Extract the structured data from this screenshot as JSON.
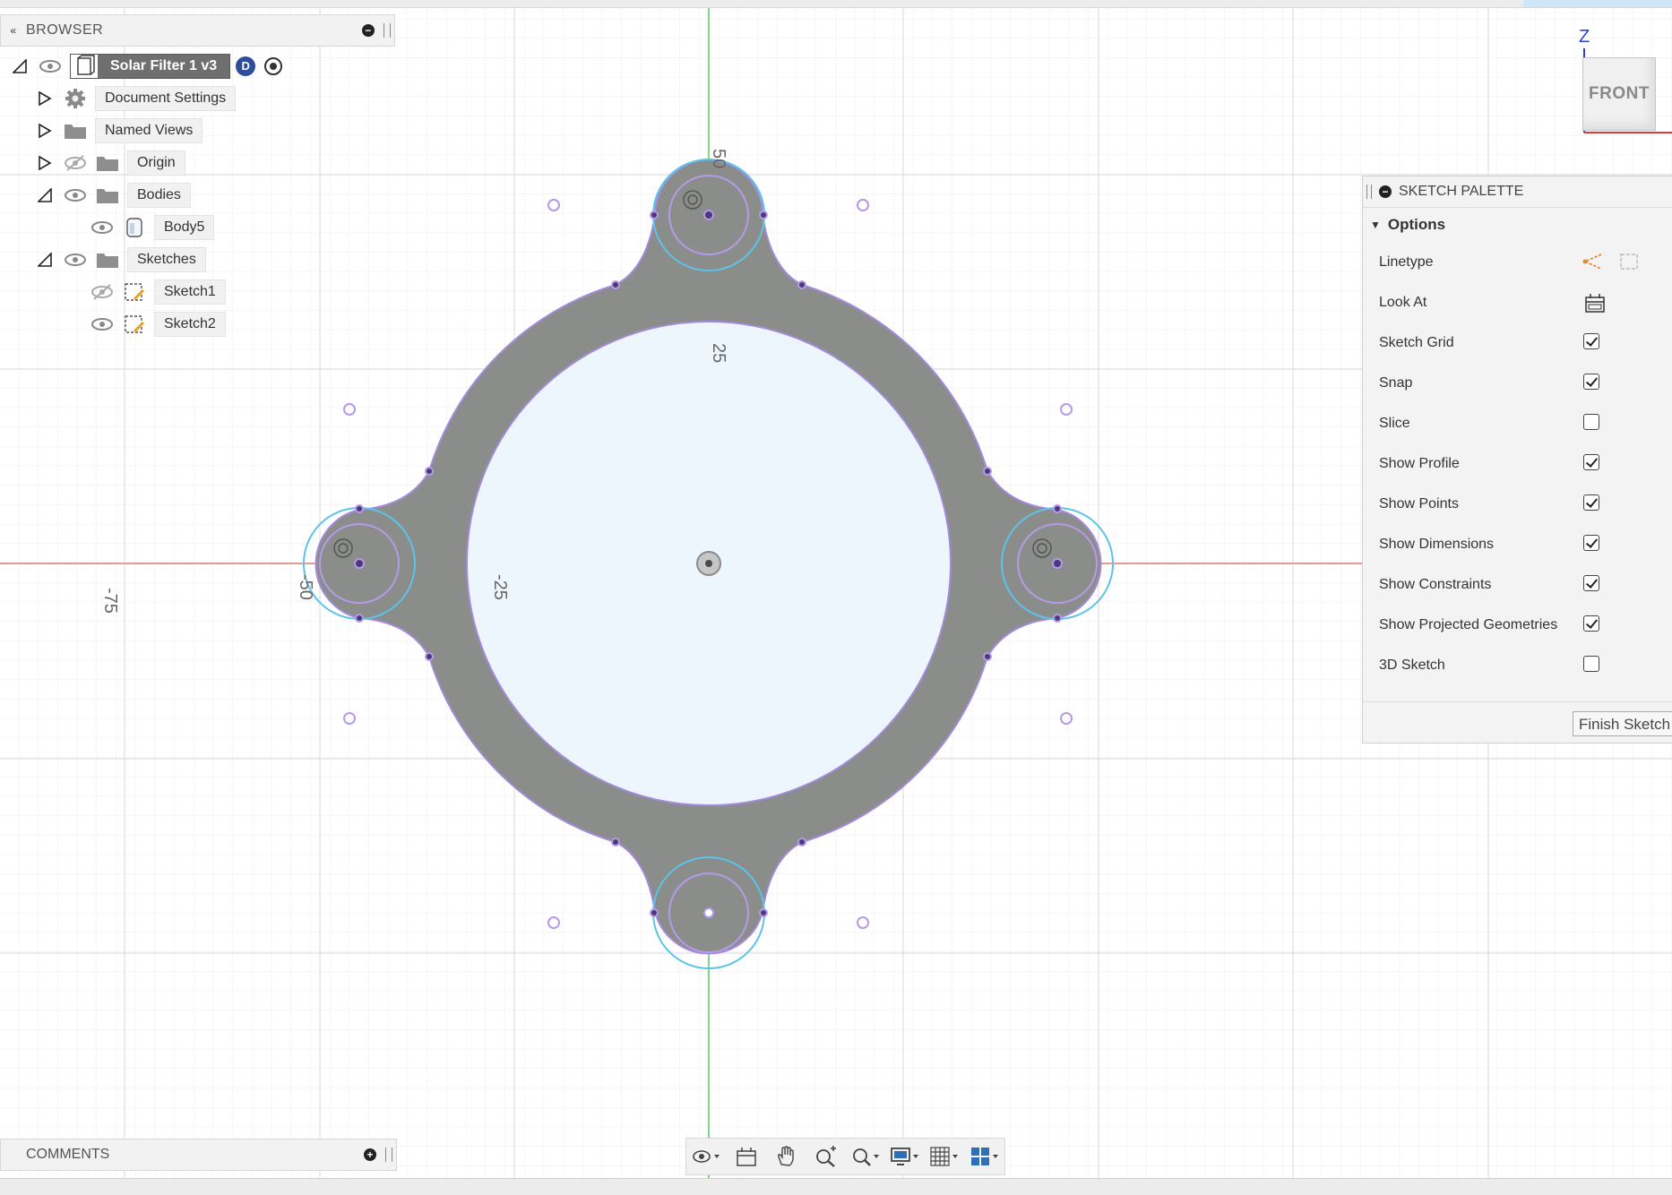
{
  "browser": {
    "title": "BROWSER",
    "collapse_icon": "«",
    "items": [
      {
        "label": "Solar Filter 1 v3",
        "icon": "component-icon",
        "badge": "D"
      },
      {
        "label": "Document Settings",
        "icon": "gear-icon"
      },
      {
        "label": "Named Views",
        "icon": "folder-icon"
      },
      {
        "label": "Origin",
        "icon": "folder-icon",
        "hidden": true
      },
      {
        "label": "Bodies",
        "icon": "folder-icon"
      },
      {
        "label": "Body5",
        "icon": "body-icon"
      },
      {
        "label": "Sketches",
        "icon": "folder-icon"
      },
      {
        "label": "Sketch1",
        "icon": "sketch-icon",
        "hidden": true
      },
      {
        "label": "Sketch2",
        "icon": "sketch-icon"
      }
    ]
  },
  "comments": {
    "title": "COMMENTS"
  },
  "viewcube": {
    "face": "FRONT",
    "axis": "Z"
  },
  "canvas": {
    "ruler_labels": {
      "x": [
        "-75",
        "-50",
        "-25"
      ],
      "y": [
        "50",
        "25"
      ]
    },
    "colors": {
      "body": "#8a8c8a",
      "inner": "#eef6fd",
      "sketch_line": "#9f86d6",
      "projected": "#5cc4e8",
      "x_axis": "#e08a8a",
      "y_axis": "#7fd68b",
      "grid": "#e3e6ea"
    }
  },
  "palette": {
    "title": "SKETCH PALETTE",
    "section": "Options",
    "options": [
      {
        "label": "Linetype",
        "type": "linetype"
      },
      {
        "label": "Look At",
        "type": "lookat"
      },
      {
        "label": "Sketch Grid",
        "type": "check",
        "checked": true
      },
      {
        "label": "Snap",
        "type": "check",
        "checked": true
      },
      {
        "label": "Slice",
        "type": "check",
        "checked": false
      },
      {
        "label": "Show Profile",
        "type": "check",
        "checked": true
      },
      {
        "label": "Show Points",
        "type": "check",
        "checked": true
      },
      {
        "label": "Show Dimensions",
        "type": "check",
        "checked": true
      },
      {
        "label": "Show Constraints",
        "type": "check",
        "checked": true
      },
      {
        "label": "Show Projected Geometries",
        "type": "check",
        "checked": true
      },
      {
        "label": "3D Sketch",
        "type": "check",
        "checked": false
      }
    ],
    "finish_label": "Finish Sketch"
  },
  "navbar": {
    "tools": [
      "orbit-icon",
      "look-at-icon",
      "pan-icon",
      "zoom-icon",
      "fit-icon",
      "display-settings-icon",
      "grid-settings-icon",
      "viewports-icon"
    ]
  }
}
